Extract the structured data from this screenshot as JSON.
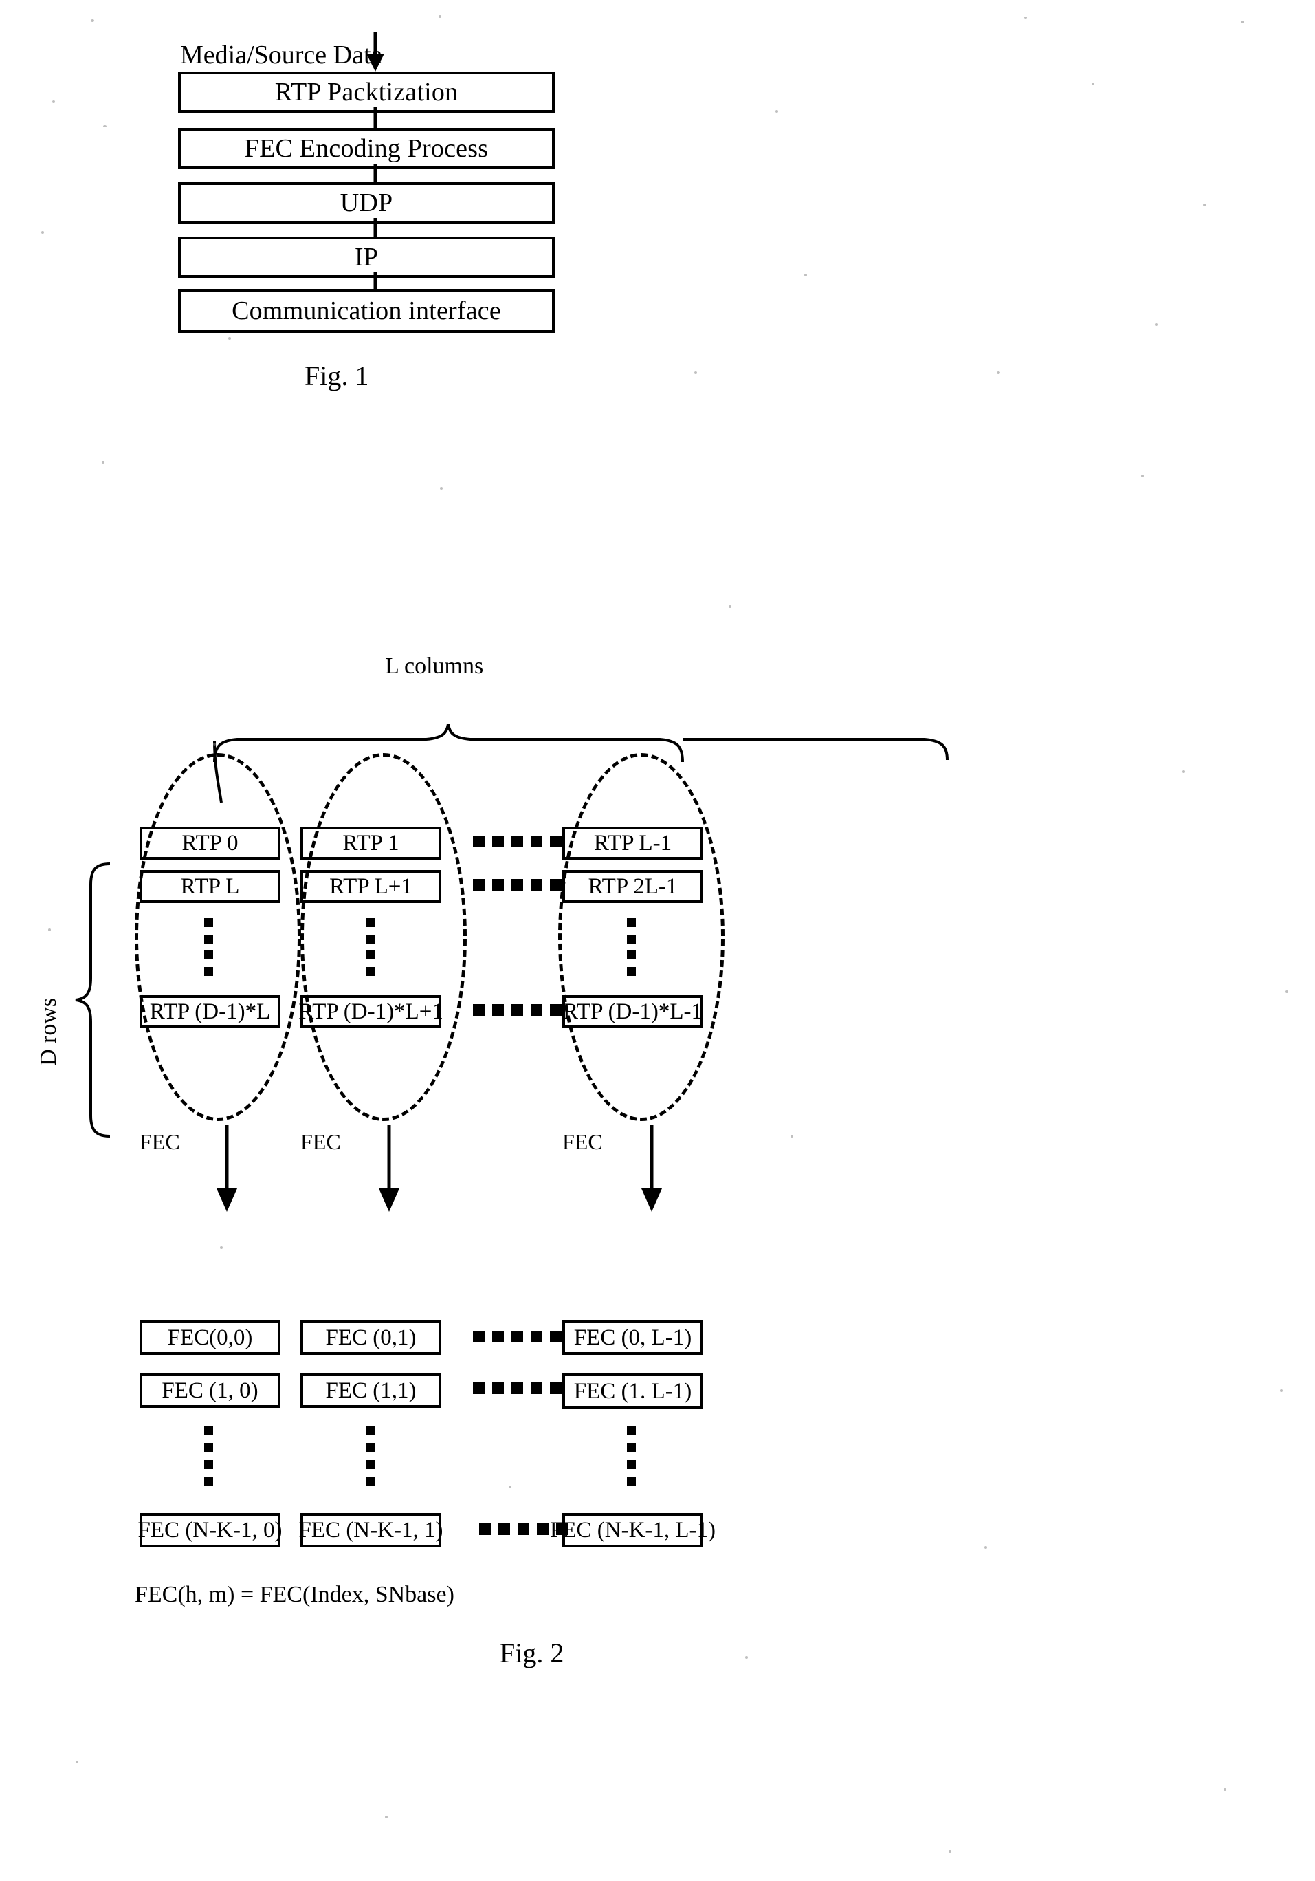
{
  "document": {
    "type": "patent-figure-sheet"
  },
  "fig1": {
    "caption": "Fig. 1",
    "input_label": "Media/Source Data",
    "stages": [
      {
        "label": "RTP Packtization"
      },
      {
        "label": "FEC Encoding Process"
      },
      {
        "label": "UDP"
      },
      {
        "label": "IP"
      },
      {
        "label": "Communication interface"
      }
    ]
  },
  "fig2": {
    "caption": "Fig. 2",
    "columns_label": "L columns",
    "rows_label": "D rows",
    "fec_arrow_label": "FEC",
    "formula": "FEC(h, m) = FEC(Index, SNbase)",
    "rtp_rows": [
      {
        "cells": [
          "RTP 0",
          "RTP 1",
          "RTP L-1"
        ]
      },
      {
        "cells": [
          "RTP L",
          "RTP L+1",
          "RTP 2L-1"
        ]
      },
      {
        "cells": [
          "RTP (D-1)*L",
          "RTP (D-1)*L+1",
          "RTP (D-1)*L-1"
        ]
      }
    ],
    "fec_rows": [
      {
        "cells": [
          "FEC(0,0)",
          "FEC (0,1)",
          "FEC (0, L-1)"
        ]
      },
      {
        "cells": [
          "FEC (1, 0)",
          "FEC (1,1)",
          "FEC (1. L-1)"
        ]
      },
      {
        "cells": [
          "FEC (N-K-1, 0)",
          "FEC (N-K-1, 1)",
          "FEC (N-K-1, L-1)"
        ]
      }
    ]
  }
}
